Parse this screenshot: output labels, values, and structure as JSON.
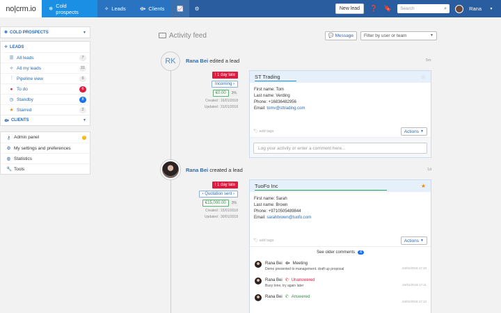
{
  "app": {
    "logo": "no|crm.io"
  },
  "topnav": {
    "tabs": [
      {
        "label": "Cold prospects",
        "icon": "snowflake-icon"
      },
      {
        "label": "Leads",
        "icon": "target-icon"
      },
      {
        "label": "Clients",
        "icon": "handshake-icon"
      }
    ],
    "new_lead": "New lead",
    "search_placeholder": "Search",
    "user": "Rana"
  },
  "sidebar": {
    "cold_prospects": "COLD PROSPECTS",
    "leads_head": "LEADS",
    "leads_items": [
      {
        "label": "All leads",
        "count": "7"
      },
      {
        "label": "All my leads",
        "count": "31"
      },
      {
        "label": "Pipeline view",
        "count": "6"
      },
      {
        "label": "To do",
        "count": "6"
      },
      {
        "label": "Standby",
        "count": "8"
      },
      {
        "label": "Starred",
        "count": "2"
      }
    ],
    "clients_head": "CLIENTS",
    "admin_items": [
      {
        "label": "Admin panel"
      },
      {
        "label": "My settings and preferences"
      },
      {
        "label": "Statistics"
      },
      {
        "label": "Tools"
      }
    ]
  },
  "main": {
    "title": "Activity feed",
    "message_btn": "Message",
    "filter_placeholder": "Filter by user or team"
  },
  "entries": [
    {
      "initials": "RK",
      "user": "Rana Bei",
      "action": "edited a lead",
      "time": "5m",
      "late": "! 1 day late",
      "stage": "Incoming",
      "amount": "€0.00",
      "pct": "3%",
      "created": "Created : 16/01/2018",
      "updated": "Updated : 31/01/2018",
      "card": {
        "title": "ST Trading",
        "lines": [
          "First name: Tom",
          "Last name: Verding",
          "Phone: +16836482956"
        ],
        "email_label": "Email: ",
        "email": "tomv@sttrading.com",
        "tags": "add tags",
        "actions": "Actions",
        "log_placeholder": "Log your activity or enter a comment here..."
      }
    },
    {
      "user": "Rana Bei",
      "action": "created a lead",
      "time": "1d",
      "late": "! 1 day late",
      "stage": "Quotation sent",
      "amount": "€15,000.00",
      "pct": "3%",
      "created": "Created : 15/01/2018",
      "updated": "Updated : 30/01/2018",
      "card": {
        "title": "TuoFo Inc",
        "lines": [
          "First name: Sarah",
          "Last name: Brown",
          "Phone: +9710505489844"
        ],
        "email_label": "Email: ",
        "email": "sarahbrown@tuofo.com",
        "tags": "add tags",
        "actions": "Actions",
        "older": "See older comments",
        "older_count": "4",
        "comments": [
          {
            "user": "Rana Bei",
            "type": "Meeting",
            "text": "Demo presented to management. draft up proposal",
            "ts": "24/01/2018 17:10"
          },
          {
            "user": "Rana Bei",
            "type": "Unanswered",
            "text": "Busy tone, try again later",
            "ts": "24/01/2018 17:11"
          },
          {
            "user": "Rana Bei",
            "type": "Answered",
            "text": "",
            "ts": "24/01/2018 17:12"
          }
        ]
      }
    }
  ],
  "colors": {
    "nav": "#2a5d9f",
    "accent": "#1a8fe3",
    "late": "#e0193f",
    "ok": "#2f8f45"
  }
}
